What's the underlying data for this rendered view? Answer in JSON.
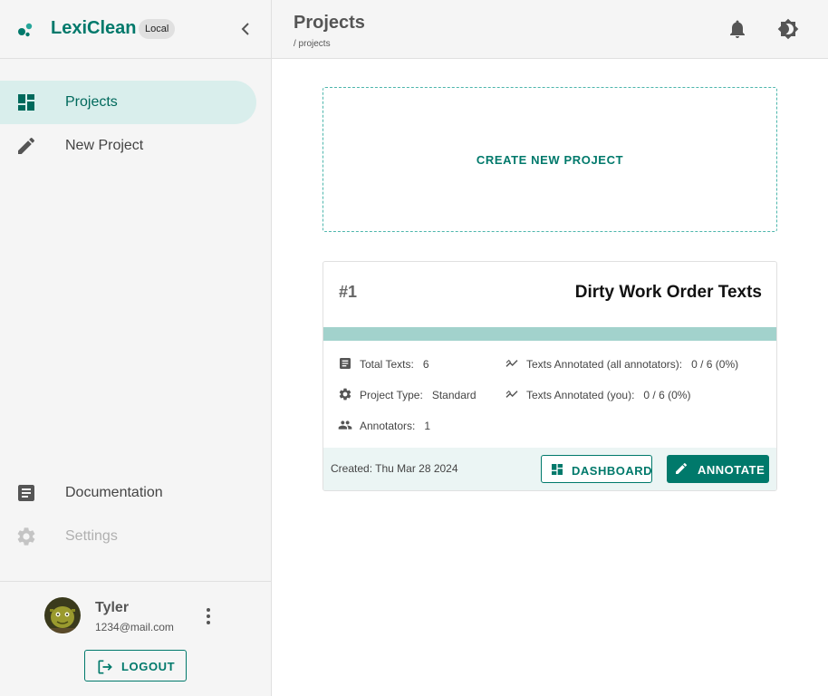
{
  "brand": {
    "name": "LexiClean",
    "badge": "Local"
  },
  "nav": {
    "items": [
      {
        "label": "Projects",
        "icon": "dashboard-icon",
        "active": true
      },
      {
        "label": "New Project",
        "icon": "pencil-icon"
      }
    ],
    "bottom_items": [
      {
        "label": "Documentation",
        "icon": "document-icon"
      },
      {
        "label": "Settings",
        "icon": "gear-icon",
        "disabled": true
      }
    ]
  },
  "user": {
    "name": "Tyler",
    "email": "1234@mail.com",
    "logout_label": "LOGOUT"
  },
  "header": {
    "title": "Projects",
    "breadcrumb": "/ projects"
  },
  "main": {
    "create_label": "CREATE NEW PROJECT",
    "projects": [
      {
        "number": "#1",
        "title": "Dirty Work Order Texts",
        "total_texts_label": "Total Texts:",
        "total_texts": "6",
        "project_type_label": "Project Type:",
        "project_type": "Standard",
        "annotators_label": "Annotators:",
        "annotators": "1",
        "annotated_all_label": "Texts Annotated (all annotators):",
        "annotated_all": "0 / 6 (0%)",
        "annotated_you_label": "Texts Annotated (you):",
        "annotated_you": "0 / 6 (0%)",
        "created": "Created: Thu Mar 28 2024",
        "dashboard_label": "DASHBOARD",
        "annotate_label": "ANNOTATE"
      }
    ]
  },
  "colors": {
    "primary": "#00796b",
    "active_bg": "#d9eeec",
    "progress": "#a2d2cc",
    "footer_bg": "#ebf5f4"
  }
}
